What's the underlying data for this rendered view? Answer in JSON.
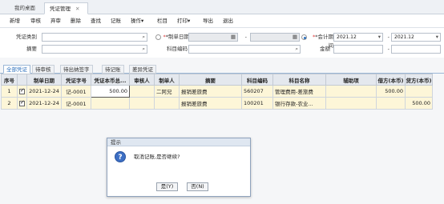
{
  "tabs": {
    "home": "我的桌面",
    "active": "凭证管理",
    "close": "✕"
  },
  "toolbar": [
    "新增",
    "审核",
    "弃审",
    "删除",
    "查找",
    "记账",
    "操作▾",
    "栏目",
    "打印▾",
    "导出",
    "退出"
  ],
  "filter": {
    "voucher_type_label": "凭证类别",
    "voucher_type_value": "",
    "make_date_label": "*制单日期",
    "period_label": "*会计期间",
    "period_from": "2021.12",
    "period_to": "2021.12",
    "dash": "-",
    "summary_label": "摘要",
    "subject_label": "科目编码",
    "amount_label": "金额",
    "amount_dash": "-"
  },
  "subtabs": [
    "全部凭证",
    "待审核",
    "待出纳签字",
    "待记账",
    "差异凭证"
  ],
  "grid": {
    "headers": [
      "序号",
      "",
      "制单日期",
      "凭证字号",
      "凭证本币总...",
      "审核人",
      "制单人",
      "摘要",
      "科目编码",
      "科目名称",
      "辅助项",
      "借方(本币)",
      "贷方(本币)"
    ],
    "rows": [
      {
        "no": "1",
        "date": "2021-12-24",
        "voucher": "记-0001",
        "total": "500.00",
        "auditor": "",
        "maker": "二阿兄",
        "summary": "报销差旅费",
        "code": "560207",
        "name": "管理费用-差旅费",
        "aux": "",
        "debit": "500.00",
        "credit": ""
      },
      {
        "no": "2",
        "date": "2021-12-24",
        "voucher": "记-0001",
        "total": "",
        "auditor": "",
        "maker": "",
        "summary": "报销差旅费",
        "code": "100201",
        "name": "银行存款-农业...",
        "aux": "",
        "debit": "",
        "credit": "500.00"
      }
    ]
  },
  "dialog": {
    "title": "提示",
    "message": "取消记账,是否继续?",
    "yes": "是(Y)",
    "no": "否(N)"
  },
  "icons": {
    "search": "⌕",
    "calendar": "▦",
    "dropdown": "▾",
    "question": "?"
  }
}
